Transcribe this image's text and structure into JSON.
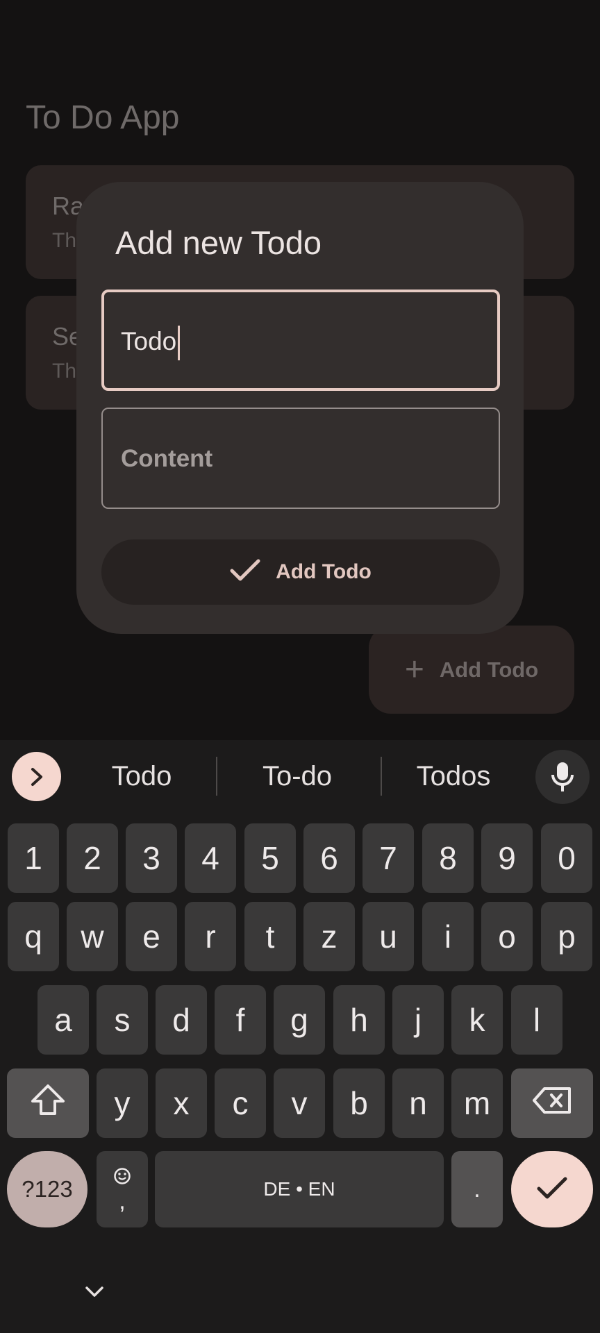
{
  "app": {
    "title": "To Do App",
    "cards": [
      {
        "title": "Ra",
        "subtitle": "Th"
      },
      {
        "title": "Se",
        "subtitle": "Th"
      }
    ],
    "fab_label": "Add Todo"
  },
  "dialog": {
    "title": "Add new Todo",
    "todo_value": "Todo",
    "content_placeholder": "Content",
    "button_label": "Add Todo"
  },
  "keyboard": {
    "suggestions": [
      "Todo",
      "To-do",
      "Todos"
    ],
    "row_numbers": [
      "1",
      "2",
      "3",
      "4",
      "5",
      "6",
      "7",
      "8",
      "9",
      "0"
    ],
    "row_q": [
      "q",
      "w",
      "e",
      "r",
      "t",
      "z",
      "u",
      "i",
      "o",
      "p"
    ],
    "row_a": [
      "a",
      "s",
      "d",
      "f",
      "g",
      "h",
      "j",
      "k",
      "l"
    ],
    "row_y": [
      "y",
      "x",
      "c",
      "v",
      "b",
      "n",
      "m"
    ],
    "sym_label": "?123",
    "comma_label": ",",
    "space_label": "DE • EN",
    "period_label": ".",
    "accent_color": "#f5d7cf"
  },
  "icons": {
    "suggest_toggle": "chevron-right-icon",
    "mic": "mic-icon",
    "shift": "shift-icon",
    "backspace": "backspace-icon",
    "enter": "check-icon",
    "emoji": "emoji-icon",
    "hide": "chevron-down-icon"
  }
}
